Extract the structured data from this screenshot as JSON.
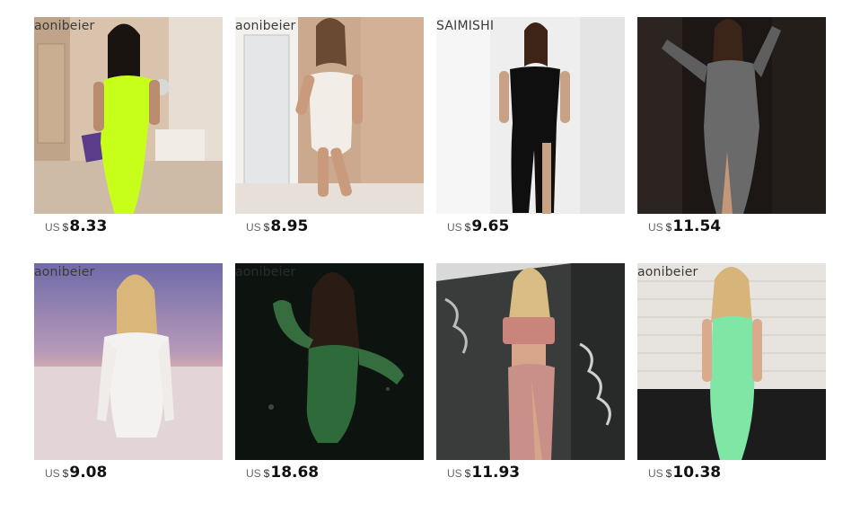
{
  "products": [
    {
      "brand": "aonibeier",
      "currency": "US",
      "symbol": "$",
      "price": "8.33",
      "image": "neon-yellow-strapless-midi-dress"
    },
    {
      "brand": "aonibeier",
      "currency": "US",
      "symbol": "$",
      "price": "8.95",
      "image": "white-strapless-mini-dress"
    },
    {
      "brand": "SAIMISHI",
      "currency": "US",
      "symbol": "$",
      "price": "9.65",
      "image": "black-strapless-slit-dress"
    },
    {
      "brand": "",
      "currency": "US",
      "symbol": "$",
      "price": "11.54",
      "image": "grey-glitter-long-sleeve-dress"
    },
    {
      "brand": "aonibeier",
      "currency": "US",
      "symbol": "$",
      "price": "9.08",
      "image": "white-off-shoulder-ruched-dress"
    },
    {
      "brand": "aonibeier",
      "currency": "US",
      "symbol": "$",
      "price": "18.68",
      "image": "green-mesh-sleeve-mini-dress"
    },
    {
      "brand": "",
      "currency": "US",
      "symbol": "$",
      "price": "11.93",
      "image": "pink-crop-top-skirt-set"
    },
    {
      "brand": "aonibeier",
      "currency": "US",
      "symbol": "$",
      "price": "10.38",
      "image": "mint-green-ruched-maxi-dress"
    }
  ],
  "colors": {
    "price_text": "#111111",
    "currency_text": "#666666",
    "background": "#ffffff"
  }
}
